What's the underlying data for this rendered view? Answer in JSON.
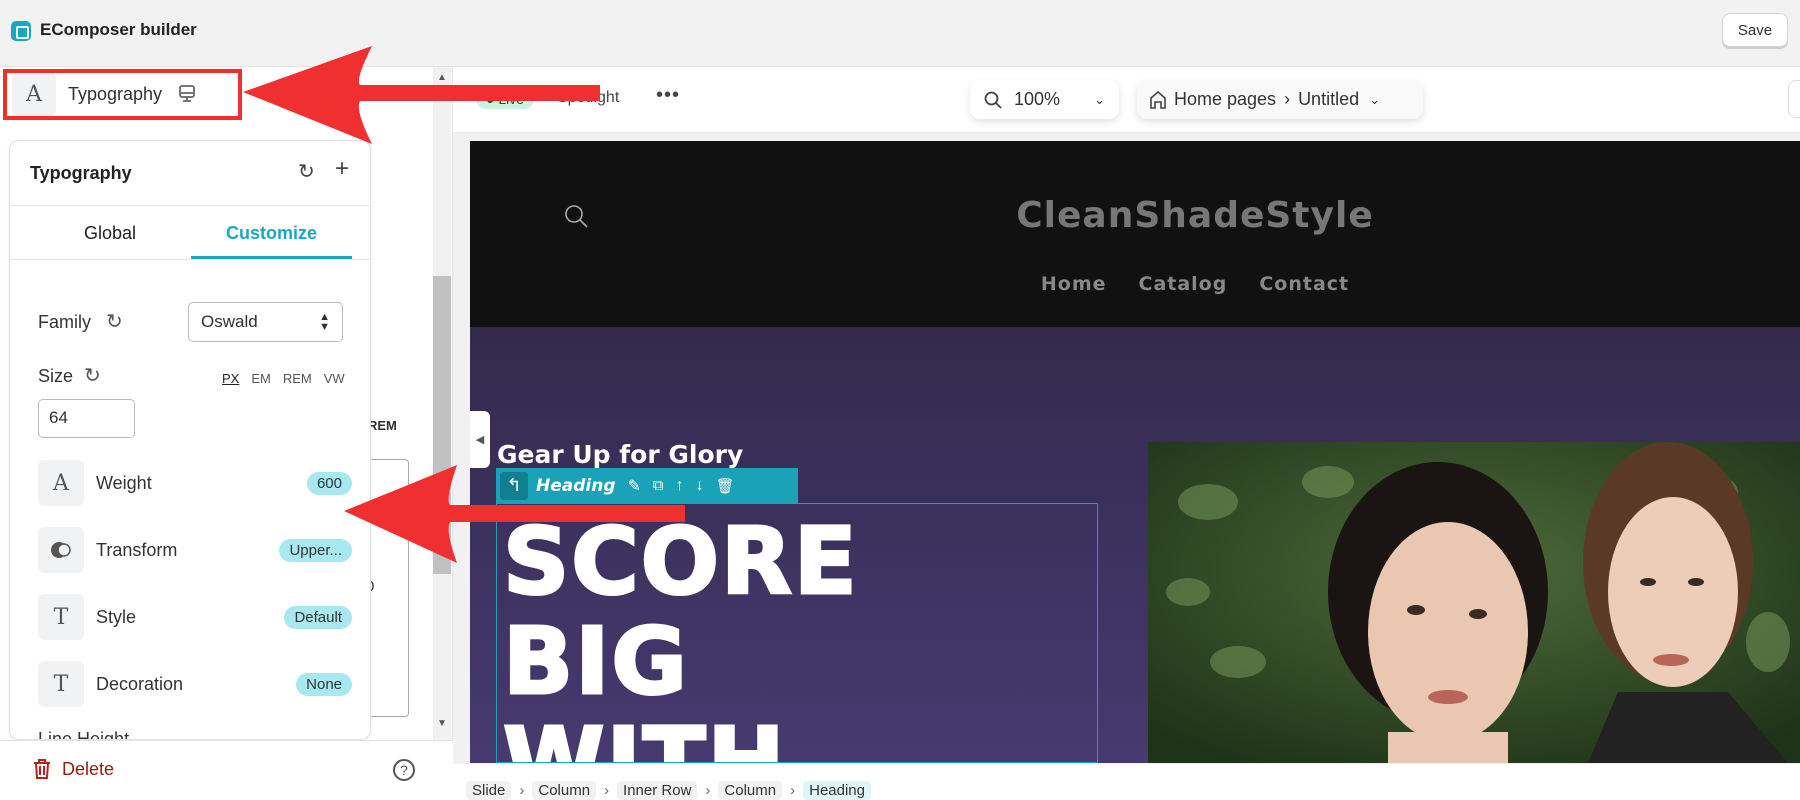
{
  "app": {
    "title": "EComposer builder",
    "save_label": "Save"
  },
  "sidebar": {
    "section_label": "Typography",
    "panel": {
      "title": "Typography",
      "tabs": [
        {
          "label": "Global",
          "active": false
        },
        {
          "label": "Customize",
          "active": true
        }
      ],
      "family": {
        "label": "Family",
        "value": "Oswald"
      },
      "size": {
        "label": "Size",
        "value": "64",
        "units": [
          "PX",
          "EM",
          "REM",
          "VW"
        ],
        "selected_unit": "PX"
      },
      "props": [
        {
          "label": "Weight",
          "value": "600",
          "icon": "letter-a-icon"
        },
        {
          "label": "Transform",
          "value": "Upper...",
          "icon": "transform-icon"
        },
        {
          "label": "Style",
          "value": "Default",
          "icon": "letter-t-icon"
        },
        {
          "label": "Decoration",
          "value": "None",
          "icon": "letter-t-icon"
        }
      ],
      "next_label": "Line Height"
    },
    "behind": {
      "unit": "REM",
      "value": "0"
    },
    "delete_label": "Delete"
  },
  "canvas": {
    "live_label": "● Live",
    "spotlight_label": "Spotlight",
    "zoom": "100%",
    "page_group": "Home pages",
    "page_name": "Untitled",
    "site": {
      "logo": "CleanShadeStyle",
      "nav": [
        "Home",
        "Catalog",
        "Contact"
      ],
      "subheading": "Gear Up for Glory",
      "heading_lines": [
        "SCORE",
        "BIG",
        "WITH"
      ],
      "element_label": "Heading"
    },
    "breadcrumb": [
      "Slide",
      "Column",
      "Inner Row",
      "Column",
      "Heading"
    ]
  },
  "colors": {
    "accent": "#17a9c2",
    "annotation": "#f03030",
    "hero": "#3d3160"
  }
}
